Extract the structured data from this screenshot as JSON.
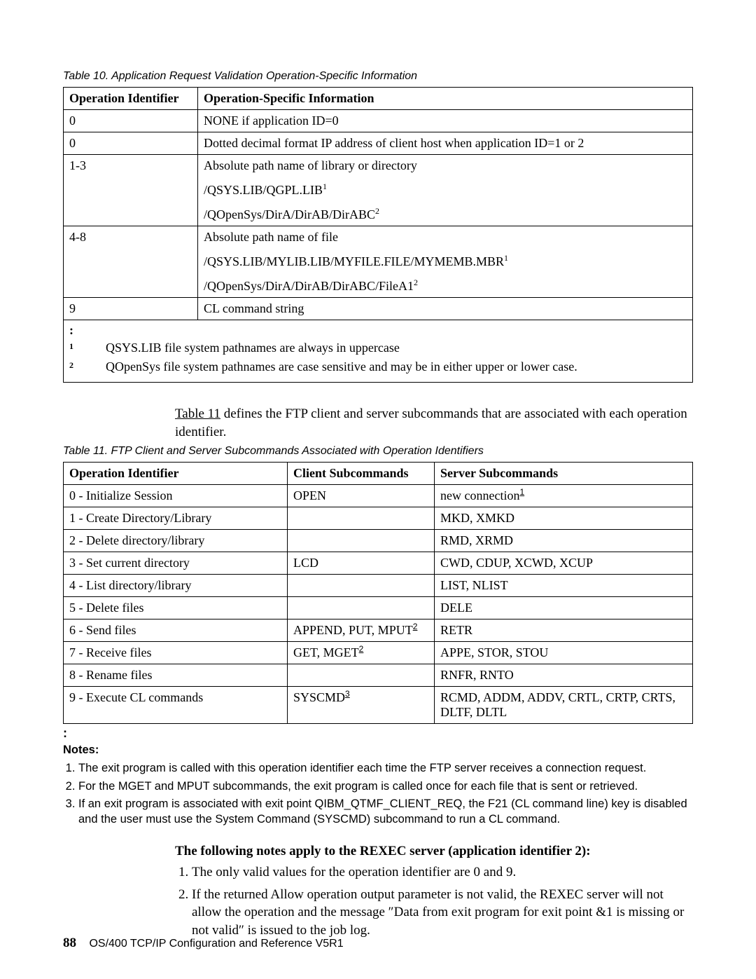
{
  "table10": {
    "caption": "Table 10. Application Request Validation Operation-Specific Information",
    "headers": {
      "col1": "Operation Identifier",
      "col2": "Operation-Specific Information"
    },
    "rows": [
      {
        "id": "0",
        "info": "NONE if application ID=0"
      },
      {
        "id": "0",
        "info": "Dotted decimal format IP address of client host when application ID=1 or 2"
      },
      {
        "id": "1-3",
        "lines": [
          {
            "text": "Absolute path name of library or directory"
          },
          {
            "text": "/QSYS.LIB/QGPL.LIB",
            "sup": "1"
          },
          {
            "text": "/QOpenSys/DirA/DirAB/DirABC",
            "sup": "2"
          }
        ]
      },
      {
        "id": "4-8",
        "lines": [
          {
            "text": "Absolute path name of file"
          },
          {
            "text": "/QSYS.LIB/MYLIB.LIB/MYFILE.FILE/MYMEMB.MBR",
            "sup": "1"
          },
          {
            "text": "/QOpenSys/DirA/DirAB/DirABC/FileA1",
            "sup": "2"
          }
        ]
      },
      {
        "id": "9",
        "info": "CL command string"
      }
    ],
    "notes_colon": ":",
    "notes": [
      {
        "sup": "1",
        "text": "QSYS.LIB file system pathnames are always in uppercase"
      },
      {
        "sup": "2",
        "text": "QOpenSys file system pathnames are case sensitive and may be in either upper or lower case."
      }
    ]
  },
  "para1": {
    "link": "Table 11",
    "rest": " defines the FTP client and server subcommands that are associated with each operation identifier."
  },
  "table11": {
    "caption": "Table 11. FTP Client and Server Subcommands Associated with Operation Identifiers",
    "headers": {
      "c1": "Operation Identifier",
      "c2": "Client Subcommands",
      "c3": "Server Subcommands"
    },
    "rows": [
      {
        "c1": "0 - Initialize Session",
        "c2": "OPEN",
        "c3": "new connection",
        "c3sup": "1"
      },
      {
        "c1": "1 - Create Directory/Library",
        "c2": "",
        "c3": "MKD, XMKD"
      },
      {
        "c1": "2 - Delete directory/library",
        "c2": "",
        "c3": "RMD, XRMD"
      },
      {
        "c1": "3 - Set current directory",
        "c2": "LCD",
        "c3": "CWD, CDUP, XCWD, XCUP"
      },
      {
        "c1": "4 - List directory/library",
        "c2": "",
        "c3": "LIST, NLIST"
      },
      {
        "c1": "5 - Delete files",
        "c2": "",
        "c3": "DELE"
      },
      {
        "c1": "6 - Send files",
        "c2": "APPEND, PUT, MPUT",
        "c2sup": "2",
        "c3": "RETR"
      },
      {
        "c1": "7 - Receive files",
        "c2": "GET, MGET",
        "c2sup": "2",
        "c3": "APPE, STOR, STOU"
      },
      {
        "c1": "8 - Rename files",
        "c2": "",
        "c3": "RNFR, RNTO"
      },
      {
        "c1": "9 - Execute CL commands",
        "c2": "SYSCMD",
        "c2sup": "3",
        "c3": "RCMD, ADDM, ADDV, CRTL, CRTP, CRTS, DLTF, DLTL"
      }
    ],
    "notes_colon": ":",
    "notes_head": "Notes:",
    "notes": [
      "The exit program is called with this operation identifier each time the FTP server receives a connection request.",
      "For the MGET and MPUT subcommands, the exit program is called once for each file that is sent or retrieved.",
      "If an exit program is associated with exit point QIBM_QTMF_CLIENT_REQ, the F21 (CL command line) key is disabled and the user must use the System Command (SYSCMD) subcommand to run a CL command."
    ]
  },
  "rexec": {
    "heading": "The following notes apply to the REXEC server (application identifier 2):",
    "items": [
      "The only valid values for the operation identifier are 0 and 9.",
      "If the returned Allow operation output parameter is not valid, the REXEC server will not allow the operation and the message ″Data from exit program for exit point &1 is missing or not valid″ is issued to the job log."
    ]
  },
  "footer": {
    "page": "88",
    "title": "OS/400 TCP/IP Configuration and Reference V5R1"
  }
}
